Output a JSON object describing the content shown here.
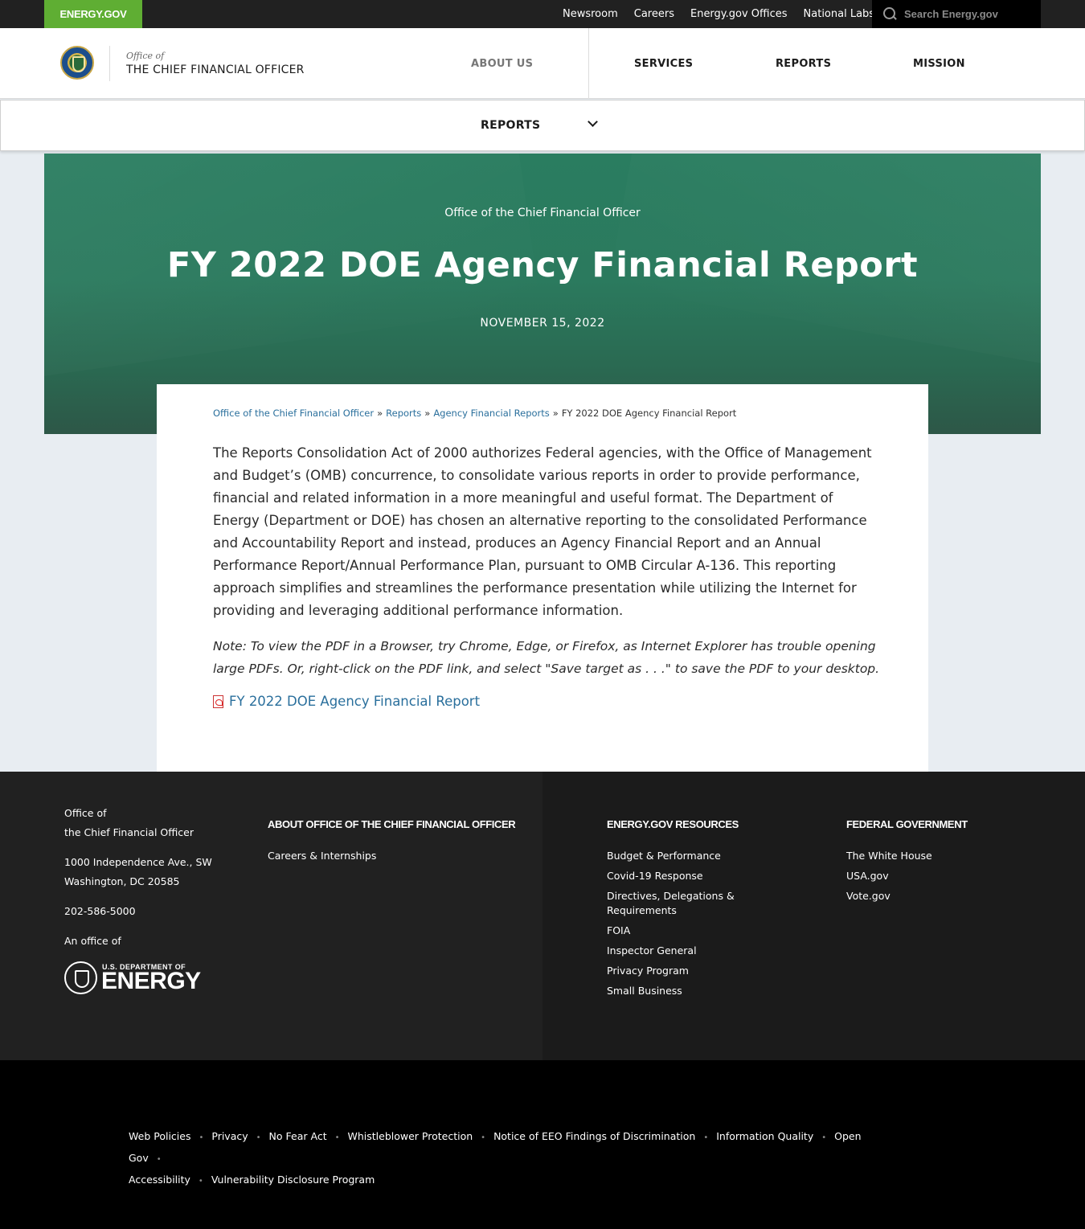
{
  "utility": {
    "brand": "ENERGY.GOV",
    "links": [
      "Newsroom",
      "Careers",
      "Energy.gov Offices",
      "National Labs"
    ],
    "search_placeholder": "Search Energy.gov"
  },
  "header": {
    "office_small": "Office of",
    "office_title": "THE CHIEF FINANCIAL OFFICER",
    "nav": {
      "about": "ABOUT US",
      "services": "SERVICES",
      "reports": "REPORTS",
      "mission": "MISSION"
    }
  },
  "subnav": {
    "label": "REPORTS"
  },
  "hero": {
    "subtitle": "Office of the Chief Financial Officer",
    "title": "FY 2022 DOE Agency Financial Report",
    "date": "NOVEMBER 15, 2022"
  },
  "breadcrumb": {
    "items": [
      "Office of the Chief Financial Officer",
      "Reports",
      "Agency Financial Reports"
    ],
    "separator": "»",
    "current": "FY 2022 DOE Agency Financial Report"
  },
  "content": {
    "body": "The Reports Consolidation Act of 2000 authorizes Federal agencies, with the Office of Management and Budget’s (OMB) concurrence, to consolidate various reports in order to provide performance, financial and related information in a more meaningful and useful format. The Department of Energy (Department or DOE) has chosen an alternative reporting to the consolidated Performance and Accountability Report and instead, produces an Agency Financial Report and an Annual Performance Report/Annual Performance Plan, pursuant to OMB Circular A-136. This reporting approach simplifies and streamlines the performance presentation while utilizing the Internet for providing and leveraging additional performance information.",
    "note": "Note:  To view the PDF in a Browser, try Chrome, Edge, or Firefox, as Internet Explorer has trouble opening large PDFs.  Or, right-click on the PDF link, and select \"Save target as . . .\" to save the PDF to your desktop.",
    "pdf_link": "FY 2022 DOE Agency Financial Report"
  },
  "footer": {
    "office_line1": "Office of",
    "office_line2": "the Chief Financial Officer",
    "address_line1": "1000 Independence Ave., SW",
    "address_line2": "Washington, DC 20585",
    "phone": "202-586-5000",
    "an_office_of": "An office of",
    "logo_small": "U.S. DEPARTMENT OF",
    "logo_big": "ENERGY",
    "about_heading": "ABOUT OFFICE OF THE CHIEF FINANCIAL OFFICER",
    "about_links": [
      "Careers & Internships"
    ],
    "resources_heading": "ENERGY.GOV RESOURCES",
    "resources_links": [
      "Budget & Performance",
      "Covid-19 Response",
      "Directives, Delegations & Requirements",
      "FOIA",
      "Inspector General",
      "Privacy Program",
      "Small Business"
    ],
    "federal_heading": "FEDERAL GOVERNMENT",
    "federal_links": [
      "The White House",
      "USA.gov",
      "Vote.gov"
    ]
  },
  "bottom": {
    "links": [
      "Web Policies",
      "Privacy",
      "No Fear Act",
      "Whistleblower Protection",
      "Notice of EEO Findings of Discrimination",
      "Information Quality",
      "Open Gov",
      "Accessibility",
      "Vulnerability Disclosure Program"
    ]
  },
  "colors": {
    "brand_green": "#5fae33",
    "hero_green": "#2a7d60",
    "link_blue": "#2a6f9c",
    "utility_dark": "#212121"
  }
}
